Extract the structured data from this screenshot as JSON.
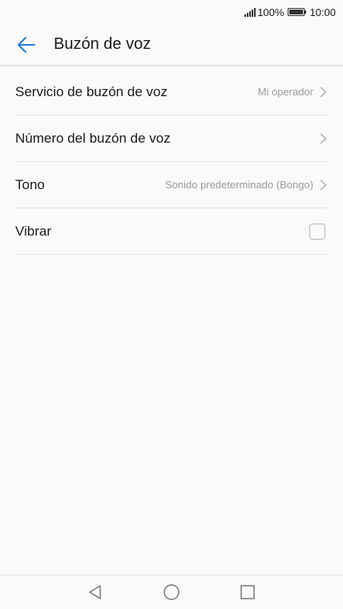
{
  "status_bar": {
    "battery_percent": "100%",
    "time": "10:00",
    "signal_icon": "signal-icon",
    "battery_icon": "battery-icon"
  },
  "app_bar": {
    "title": "Buzón de voz",
    "back_icon": "arrow-left-icon",
    "accent_color": "#2a7fd4"
  },
  "settings": {
    "items": [
      {
        "label": "Servicio de buzón de voz",
        "value": "Mi operador",
        "control": "chevron"
      },
      {
        "label": "Número del buzón de voz",
        "value": "",
        "control": "chevron"
      },
      {
        "label": "Tono",
        "value": "Sonido predeterminado (Bongo)",
        "control": "chevron"
      },
      {
        "label": "Vibrar",
        "checked": false,
        "control": "checkbox"
      }
    ]
  },
  "nav_bar": {
    "back_icon": "triangle-back-icon",
    "home_icon": "circle-home-icon",
    "recent_icon": "square-recent-icon"
  }
}
